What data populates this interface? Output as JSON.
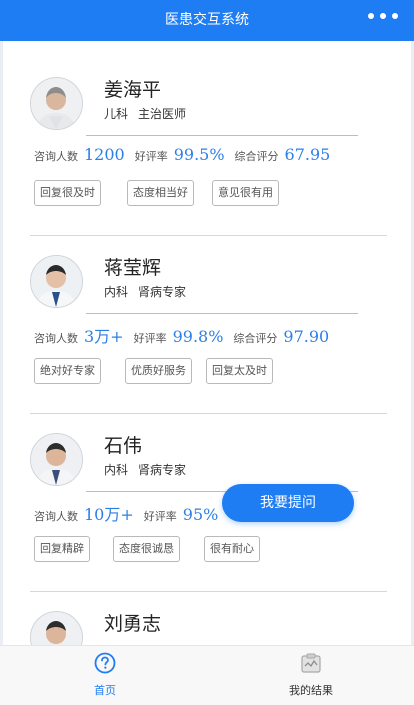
{
  "header": {
    "title": "医患交互系统",
    "more_icon": "more-dots-icon"
  },
  "labels": {
    "consult": "咨询人数",
    "rating": "好评率",
    "score": "综合评分"
  },
  "doctors": [
    {
      "name": "姜海平",
      "dept": "儿科",
      "title": "主治医师",
      "consult": "1200",
      "rating": "99.5%",
      "score": "67.95",
      "tags": [
        "回复很及时",
        "态度相当好",
        "意见很有用"
      ]
    },
    {
      "name": "蒋莹辉",
      "dept": "内科",
      "title": "肾病专家",
      "consult": "3万+",
      "rating": "99.8%",
      "score": "97.90",
      "tags": [
        "绝对好专家",
        "优质好服务",
        "回复太及时"
      ]
    },
    {
      "name": "石伟",
      "dept": "内科",
      "title": "肾病专家",
      "consult": "10万+",
      "rating": "95%",
      "score": "",
      "tags": [
        "回复精辟",
        "态度很诚恳",
        "很有耐心"
      ]
    },
    {
      "name": "刘勇志"
    }
  ],
  "fab": {
    "label": "我要提问"
  },
  "tabbar": {
    "home": "首页",
    "results": "我的结果"
  },
  "colors": {
    "primary": "#1f7df4",
    "value": "#2b7fe6"
  }
}
